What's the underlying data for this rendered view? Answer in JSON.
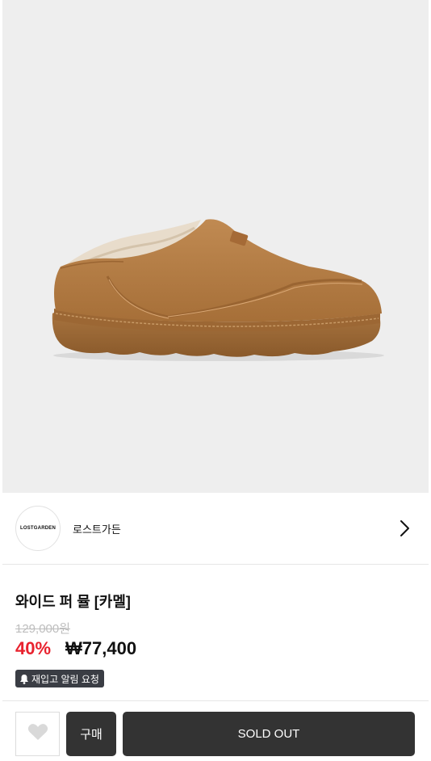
{
  "product": {
    "image_alt": "camel suede wide fur slipper",
    "title": "와이드 퍼 뮬 [카멜]",
    "original_price": "129,000원",
    "discount": "40%",
    "sale_price": "₩77,400"
  },
  "brand": {
    "logo_text": "LOSTGARDEN",
    "name": "로스트가든"
  },
  "restock": {
    "label": "재입고 알림 요청"
  },
  "actions": {
    "buy_label": "구매",
    "soldout_label": "SOLD OUT"
  },
  "icons": {
    "brand_arrow": "chevron-right-icon",
    "restock_icon": "bell-icon",
    "like_icon": "heart-icon"
  },
  "colors": {
    "discount": "#e8222e",
    "button_dark": "#333333",
    "restock_bg": "#3a3d44",
    "hero_bg": "#eeeeee"
  }
}
